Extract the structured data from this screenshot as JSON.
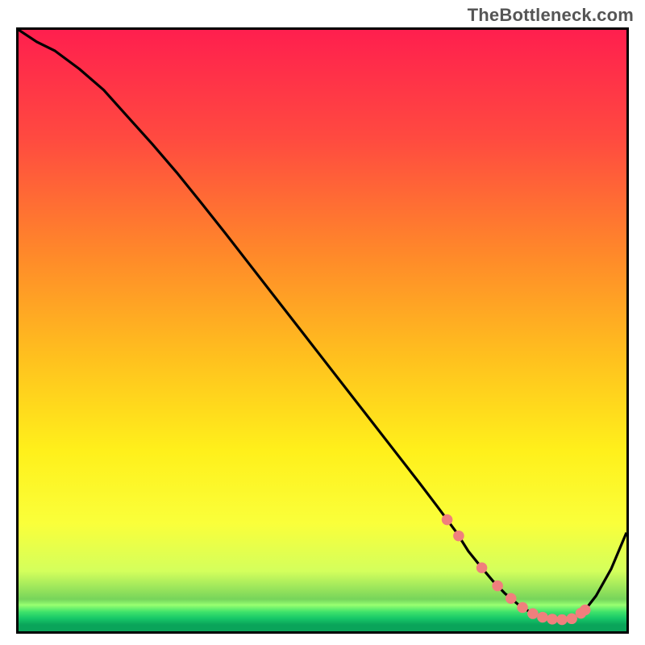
{
  "watermark": "TheBottleneck.com",
  "chart_data": {
    "type": "line",
    "title": "",
    "xlabel": "",
    "ylabel": "",
    "xlim": [
      0,
      100
    ],
    "ylim": [
      0,
      100
    ],
    "gradient_type": "vertical",
    "gradient_stops": [
      {
        "pos": 0,
        "color": "#ff1f4e"
      },
      {
        "pos": 18,
        "color": "#ff4a40"
      },
      {
        "pos": 38,
        "color": "#ff8b29"
      },
      {
        "pos": 55,
        "color": "#ffc21e"
      },
      {
        "pos": 70,
        "color": "#fff01b"
      },
      {
        "pos": 82,
        "color": "#faff3a"
      },
      {
        "pos": 90,
        "color": "#d4ff5c"
      },
      {
        "pos": 100,
        "color": "#0aa45a"
      }
    ],
    "green_strip_top_pct": 94.6,
    "series": [
      {
        "name": "curve",
        "x": [
          0,
          3,
          6,
          10,
          14,
          18,
          22,
          26,
          30,
          34,
          38,
          42,
          46,
          50,
          54,
          58,
          62,
          66,
          69,
          72,
          74,
          76,
          78,
          80,
          82.5,
          85,
          87,
          89,
          91,
          93,
          95,
          97.5,
          100
        ],
        "y": [
          100,
          98,
          96.5,
          93.5,
          90,
          85.5,
          81,
          76.3,
          71.3,
          66.2,
          61,
          55.8,
          50.6,
          45.4,
          40.2,
          35,
          29.8,
          24.6,
          20.6,
          16.5,
          13.3,
          10.8,
          8.4,
          6.3,
          4.2,
          2.7,
          2.1,
          1.9,
          2.1,
          3.3,
          5.9,
          10.4,
          16.4
        ]
      }
    ],
    "markers": {
      "color": "#f07f7d",
      "radius": 9,
      "points_on_curve_x": [
        70.5,
        72.4,
        76.2,
        78.8,
        81.0,
        82.9,
        84.6,
        86.2,
        87.8,
        89.4,
        91.0,
        92.5,
        93.2
      ]
    }
  }
}
